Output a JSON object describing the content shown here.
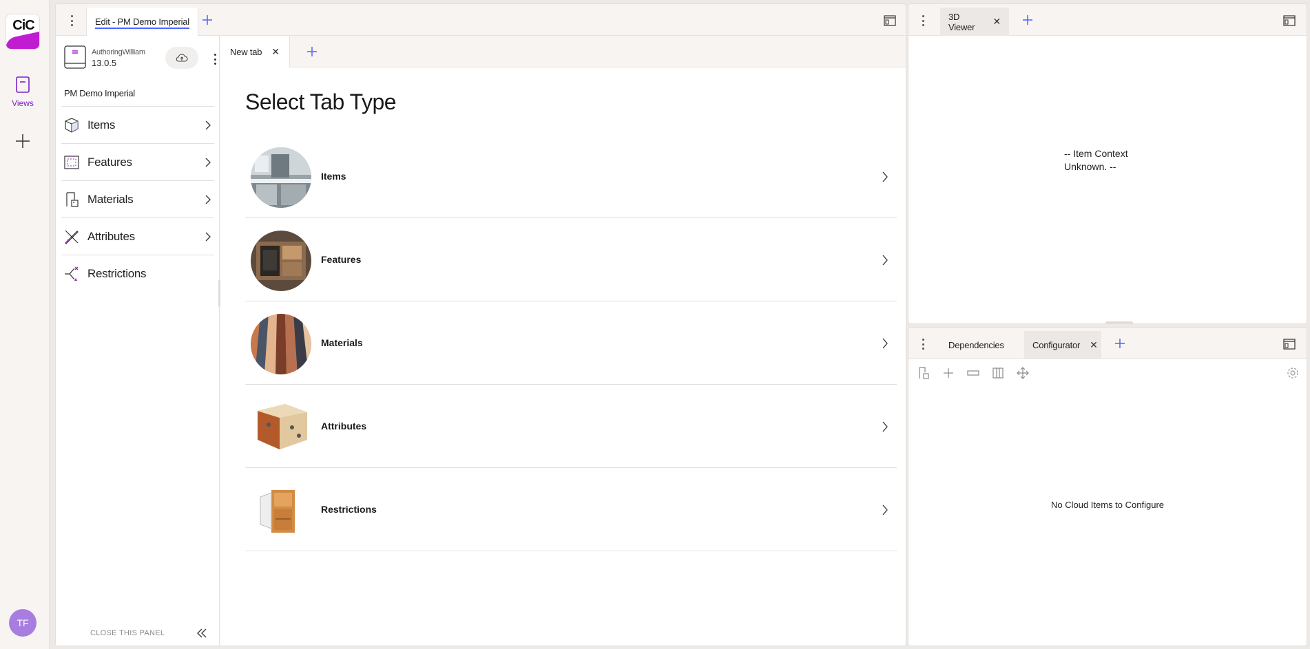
{
  "rail": {
    "logo_text": "CiC",
    "views_label": "Views",
    "avatar_initials": "TF"
  },
  "editor_panel": {
    "tab_label": "Edit - PM Demo Imperial"
  },
  "sidebar": {
    "user": "AuthoringWilliam",
    "version": "13.0.5",
    "project_name": "PM Demo Imperial",
    "items": [
      {
        "label": "Items"
      },
      {
        "label": "Features"
      },
      {
        "label": "Materials"
      },
      {
        "label": "Attributes"
      },
      {
        "label": "Restrictions"
      }
    ],
    "close_label": "CLOSE THIS PANEL"
  },
  "inner_tabs": {
    "active_tab": "New tab"
  },
  "select_tab": {
    "title": "Select Tab Type",
    "options": [
      {
        "label": "Items"
      },
      {
        "label": "Features"
      },
      {
        "label": "Materials"
      },
      {
        "label": "Attributes"
      },
      {
        "label": "Restrictions"
      }
    ]
  },
  "viewer_panel": {
    "tab_label": "3D Viewer",
    "message_line1": "-- Item Context",
    "message_line2": "Unknown. --"
  },
  "config_panel": {
    "tabs": [
      "Dependencies",
      "Configurator"
    ],
    "empty_message": "No Cloud Items to Configure"
  },
  "colors": {
    "accent": "#4d63ff",
    "brand_purple": "#7a23c7",
    "brand_magenta": "#c21cd3",
    "avatar": "#a87de0"
  }
}
